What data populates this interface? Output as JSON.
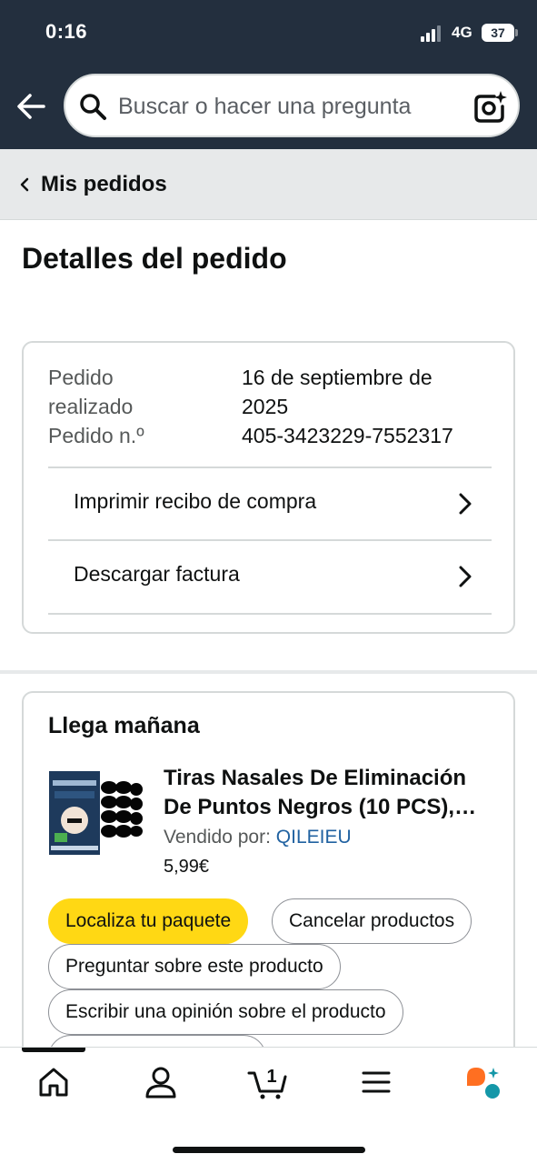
{
  "status_bar": {
    "time": "0:16",
    "network": "4G",
    "battery": "37"
  },
  "search": {
    "placeholder": "Buscar o hacer una pregunta"
  },
  "breadcrumb": {
    "label": "Mis pedidos"
  },
  "page_title": "Detalles del pedido",
  "order_info": {
    "placed_label": "Pedido realizado",
    "placed_value": "16 de septiembre de 2025",
    "number_label": "Pedido n.º",
    "number_value": "405-3423229-7552317",
    "links": [
      "Imprimir recibo de compra",
      "Descargar factura"
    ]
  },
  "delivery": {
    "title": "Llega mañana",
    "product_title": "Tiras Nasales De Eliminación De Puntos Negros (10 PCS),…",
    "sold_by_label": "Vendido por:",
    "seller": "QILEIEU",
    "price": "5,99€",
    "buttons": {
      "track": "Localiza tu paquete",
      "cancel": "Cancelar productos",
      "ask": "Preguntar sobre este producto",
      "review": "Escribir una opinión sobre el producto"
    }
  },
  "bottom_nav": {
    "items": [
      "home-icon",
      "account-icon",
      "cart-icon",
      "menu-icon",
      "rufus-icon"
    ],
    "cart_count": "1"
  },
  "colors": {
    "header": "#232f3e",
    "primary_button": "#ffd814",
    "link": "#2162a1",
    "rufus": "#ff6f21"
  }
}
